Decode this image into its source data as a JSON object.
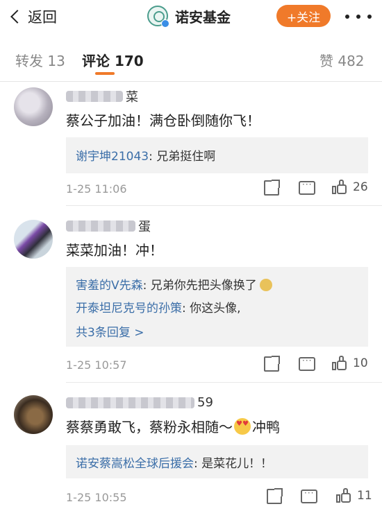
{
  "header": {
    "back_label": "返回",
    "title": "诺安基金",
    "follow_label": "+关注"
  },
  "tabs": [
    {
      "label": "转发 13",
      "active": false
    },
    {
      "label": "评论 170",
      "active": true
    },
    {
      "label": "赞 482",
      "active": false
    }
  ],
  "comments": [
    {
      "username_visible": "菜",
      "text": "蔡公子加油！满仓卧倒随你飞！",
      "replies": [
        {
          "name": "谢宇坤21043",
          "text": ": 兄弟挺住啊"
        }
      ],
      "time": "1-25 11:06",
      "likes": "26"
    },
    {
      "username_visible": "蛋",
      "text": "菜菜加油！冲！",
      "replies": [
        {
          "name": "害羞的V先森",
          "text": ": 兄弟你先把头像换了"
        },
        {
          "name": "开泰坦尼克号的孙策",
          "text": ": 你这头像,"
        }
      ],
      "more_replies": "共3条回复 >",
      "time": "1-25 10:57",
      "likes": "10"
    },
    {
      "username_visible": "59",
      "text_before": "蔡蔡勇敢飞，蔡粉永相随～",
      "text_after": "冲鸭",
      "replies": [
        {
          "name": "诺安蔡嵩松全球后援会",
          "text": ": 是菜花儿！！"
        }
      ],
      "time": "1-25 10:55",
      "likes": "11"
    }
  ],
  "icons": {
    "back": "chevron-left-icon",
    "logo": "noan-fund-logo-icon",
    "more": "more-dots-icon",
    "share": "share-icon",
    "comment": "comment-icon",
    "like": "thumbs-up-icon"
  },
  "colors": {
    "accent": "#f07a2a",
    "reply_name": "#3b6ea8",
    "reply_bg": "#f2f2f2"
  }
}
